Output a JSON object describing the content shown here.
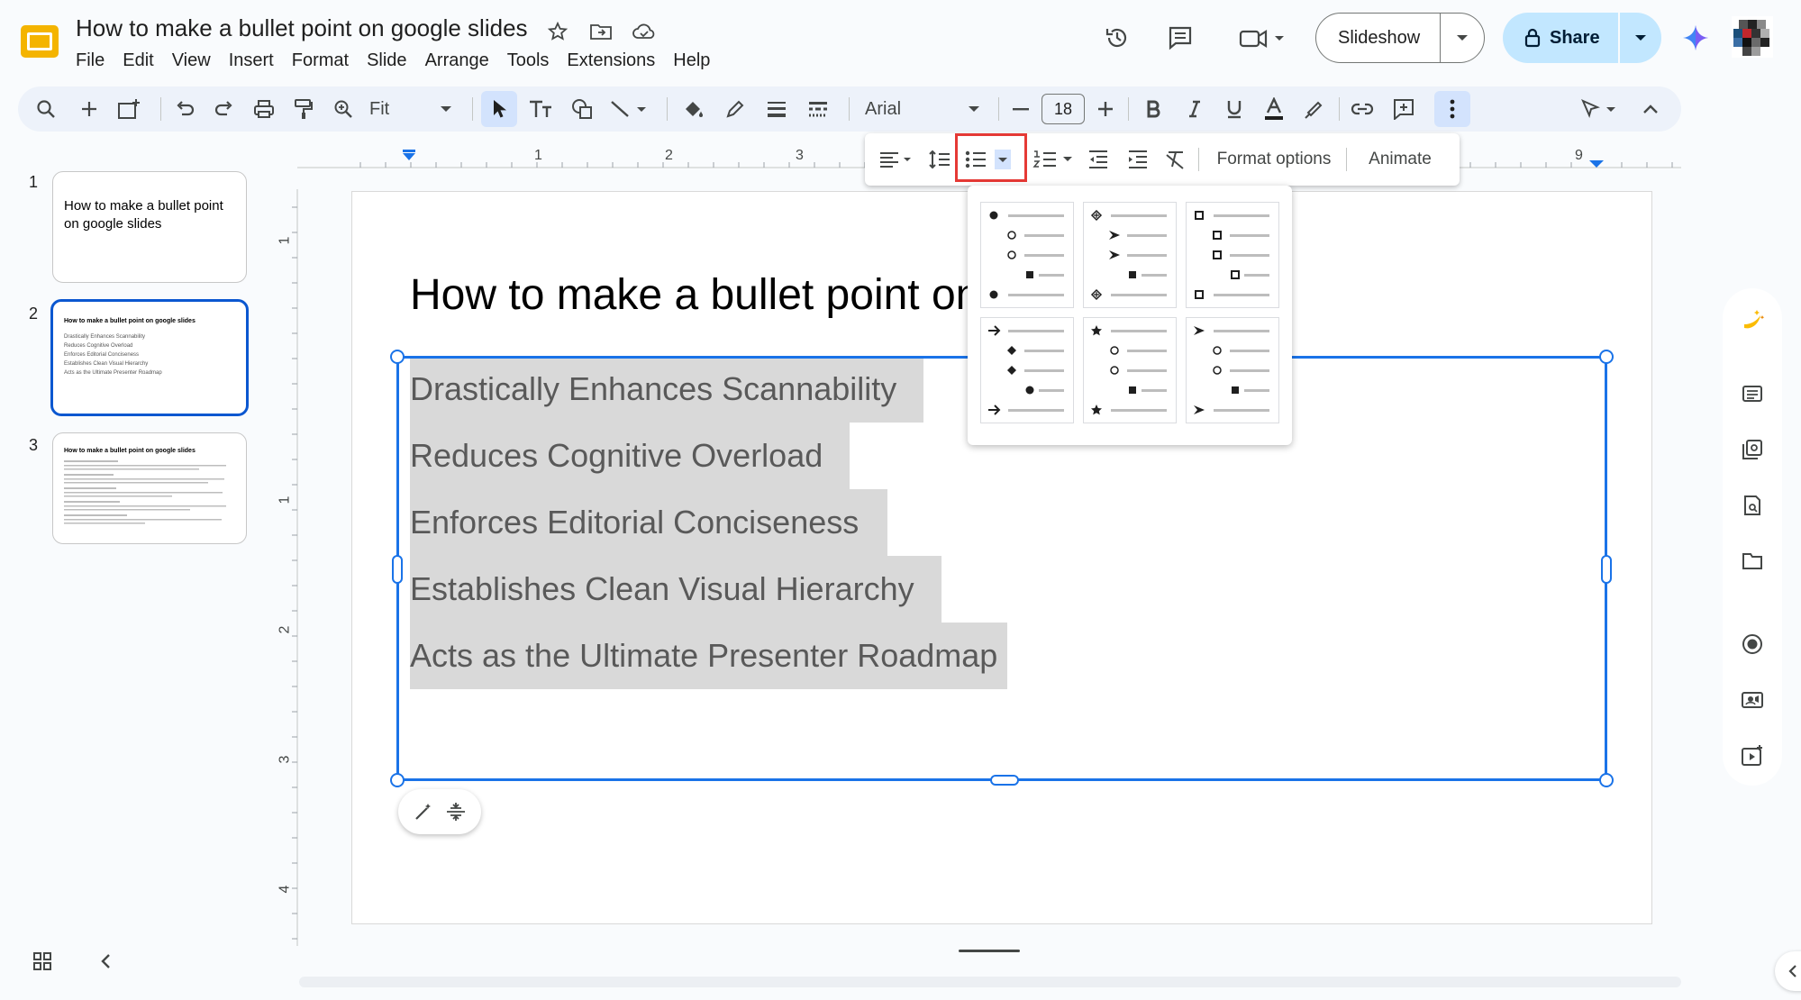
{
  "app": {
    "name": "Google Slides",
    "accent": "#0b57d0",
    "selection_color": "#1a73e8",
    "highlight_box_color": "#e53935"
  },
  "document": {
    "title": "How to make a bullet point on google slides"
  },
  "menubar": [
    "File",
    "Edit",
    "View",
    "Insert",
    "Format",
    "Slide",
    "Arrange",
    "Tools",
    "Extensions",
    "Help"
  ],
  "header": {
    "slideshow_label": "Slideshow",
    "share_label": "Share"
  },
  "toolbar": {
    "zoom_value": "Fit",
    "font_family": "Arial",
    "font_size": "18"
  },
  "subtoolbar": {
    "format_options_label": "Format options",
    "animate_label": "Animate"
  },
  "ruler": {
    "h_labels": [
      "1",
      "2",
      "3",
      "9"
    ],
    "v_labels": [
      "1",
      "1",
      "2",
      "3",
      "4"
    ]
  },
  "filmstrip": [
    {
      "number": "1",
      "title": "How to make a bullet point on google slides",
      "selected": false
    },
    {
      "number": "2",
      "title": "How to make a bullet point on google slides",
      "selected": true,
      "lines": [
        "Drastically Enhances Scannability",
        "Reduces Cognitive Overload",
        "Enforces Editorial Conciseness",
        "Establishes Clean Visual Hierarchy",
        "Acts as the Ultimate Presenter Roadmap"
      ]
    },
    {
      "number": "3",
      "title": "How to make a bullet point on google slides",
      "selected": false
    }
  ],
  "slide": {
    "title": "How to make a bullet point on google slides",
    "bullets": [
      "Drastically Enhances Scannability",
      "Reduces Cognitive Overload",
      "Enforces Editorial Conciseness",
      "Establishes Clean Visual Hierarchy",
      "Acts as the Ultimate Presenter Roadmap"
    ]
  },
  "bullet_menu": {
    "options": [
      [
        "filled-circle",
        "hollow-circle",
        "hollow-circle",
        "filled-square",
        "filled-circle"
      ],
      [
        "diamond-cross",
        "arrowhead",
        "arrowhead",
        "filled-square",
        "diamond-cross"
      ],
      [
        "hollow-square",
        "hollow-square",
        "hollow-square",
        "hollow-square",
        "hollow-square"
      ],
      [
        "arrow",
        "diamond",
        "diamond",
        "filled-circle",
        "arrow"
      ],
      [
        "star",
        "hollow-circle",
        "hollow-circle",
        "filled-square",
        "star"
      ],
      [
        "arrowhead",
        "hollow-circle",
        "hollow-circle",
        "filled-square",
        "arrowhead"
      ]
    ]
  }
}
